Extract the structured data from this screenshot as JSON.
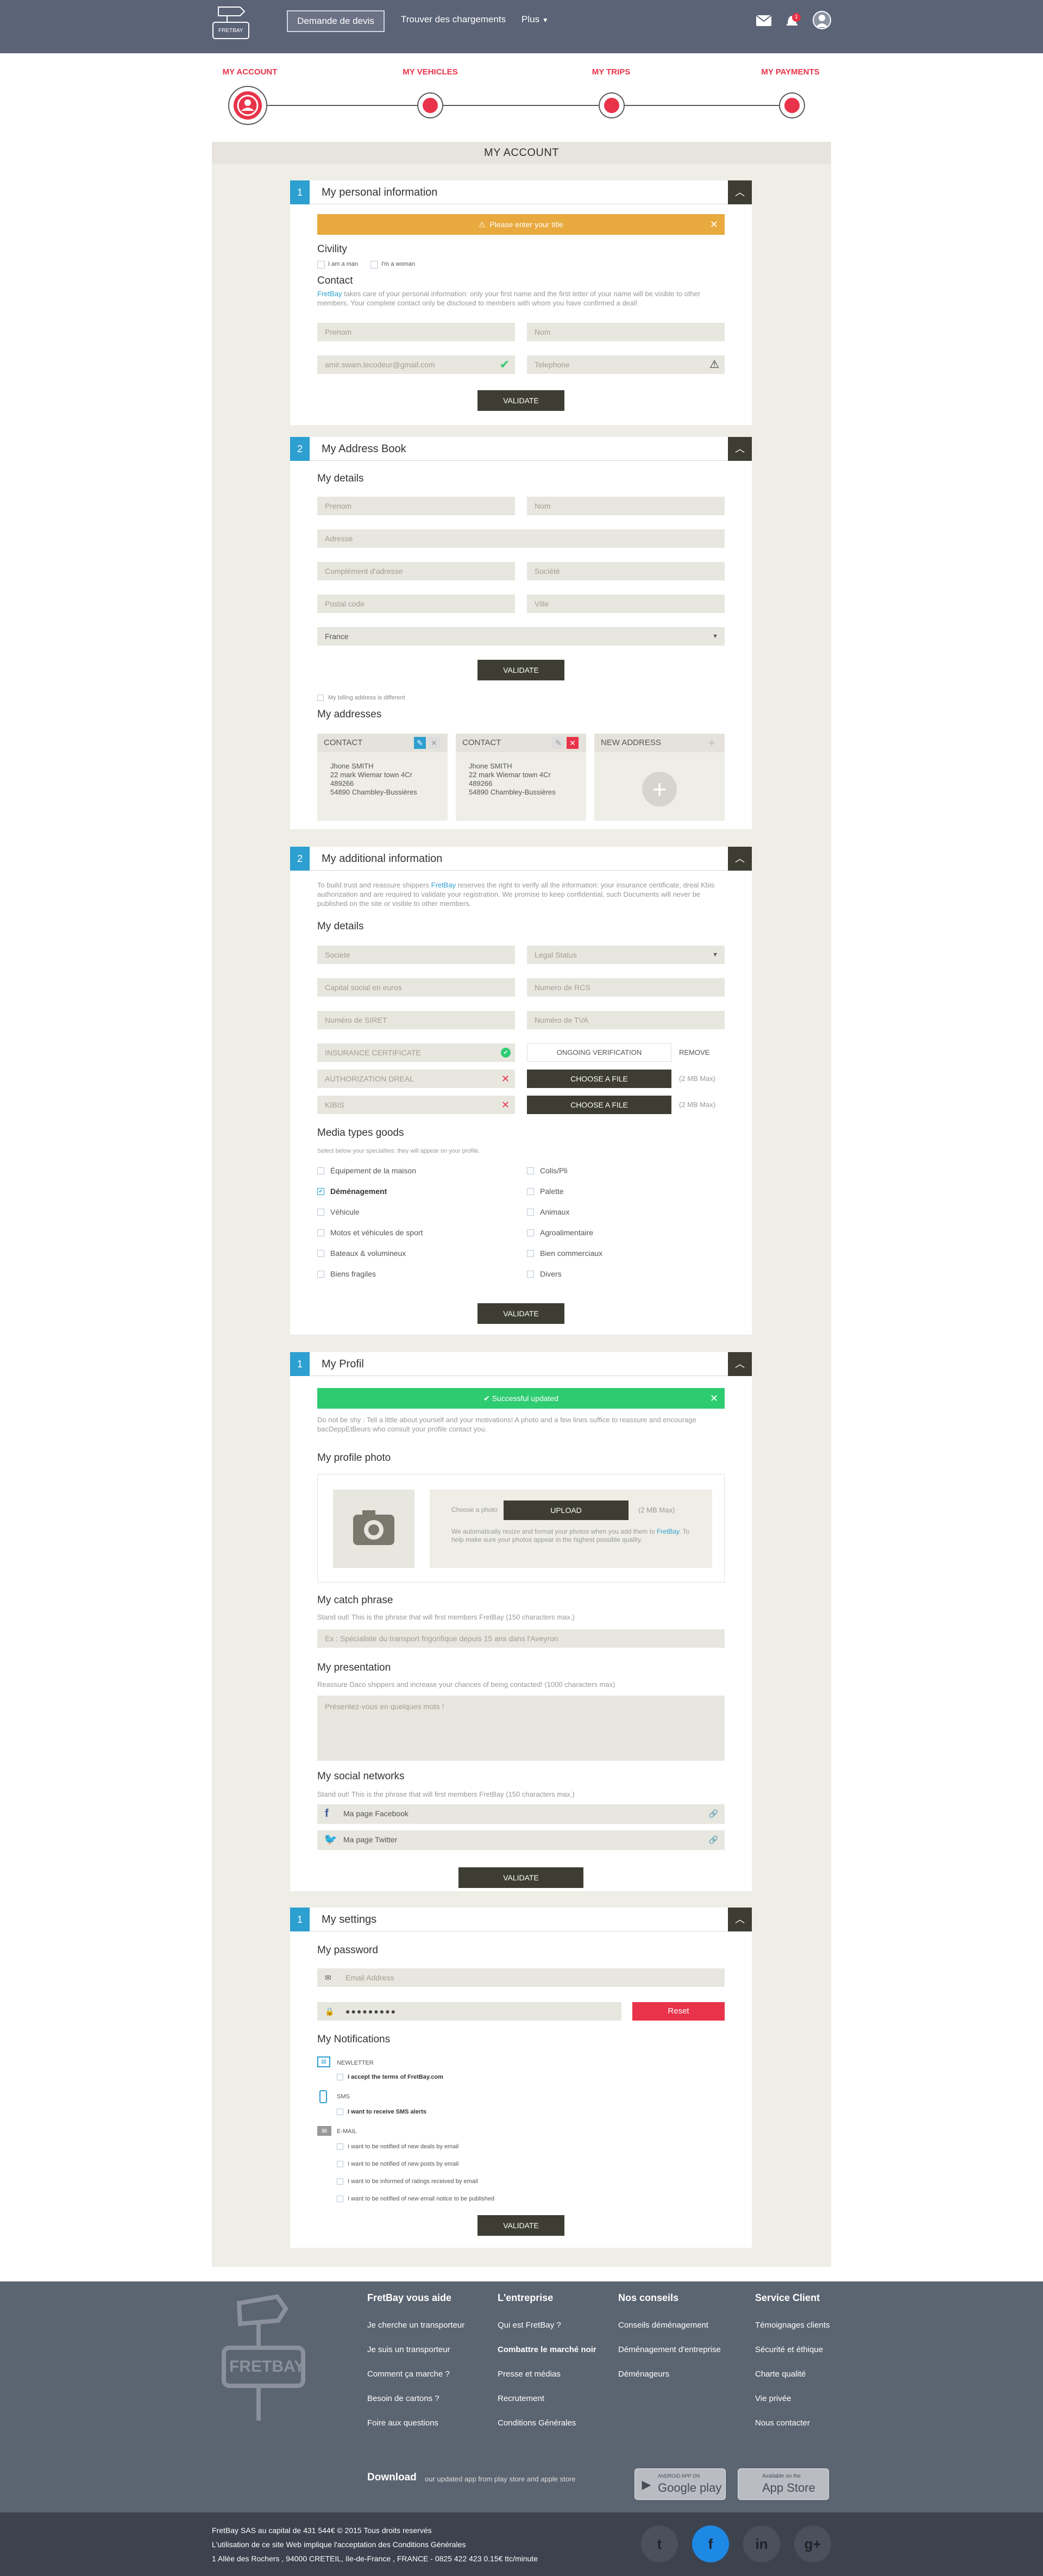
{
  "header": {
    "logo_text": "FRETBAY",
    "nav_quote": "Demande de devis",
    "nav_find": "Trouver des chargements",
    "nav_more": "Plus",
    "notif_count": "1"
  },
  "steps": [
    "MY ACCOUNT",
    "MY VEHICLES",
    "MY TRIPS",
    "MY PAYMENTS"
  ],
  "page_title": "MY ACCOUNT",
  "s1": {
    "num": "1",
    "title": "My personal information",
    "alert": "Please enter your title",
    "civility": "Civility",
    "man": "I am a man",
    "woman": "I'm a woman",
    "contact": "Contact",
    "desc_brand": "FretBay",
    "desc": " takes care of your personal information: only your first name and the first letter of your name will be visible to other members. Your complete contact only be disclosed to members with whom you have confirmed a deal!",
    "prenom": "Prenom",
    "nom": "Nom",
    "email": "amir.swam.lecodeur@gmail.com",
    "phone": "Telephone",
    "validate": "VALIDATE"
  },
  "s2": {
    "num": "2",
    "title": "My Address Book",
    "details": "My details",
    "prenom": "Prenom",
    "nom": "Nom",
    "adresse": "Adresse",
    "complement": "Complément d'adresse",
    "societe": "Société",
    "postal": "Postal code",
    "ville": "Ville",
    "country": "France",
    "validate": "VALIDATE",
    "billing": "My billing address is different",
    "addresses": "My addresses",
    "card_title": "CONTACT",
    "card_lines": [
      "Jhone SMITH",
      "22 mark Wiemar town 4Cr",
      "489266",
      "54890 Chambley-Bussières"
    ],
    "new_address": "NEW ADDRESS"
  },
  "s3": {
    "num": "2",
    "title": "My additional information",
    "intro_a": "To build trust and reassure shippers ",
    "intro_brand": "FretBay",
    "intro_b": " reserves the right to verify all the information: your insurance certificate, dreal Kbis authorization and are required to validate your registration. We promise to keep confidential, such Documents will never be published on the site or visible to other members.",
    "details": "My details",
    "societe": "Societe",
    "legal": "Legal Status",
    "capital": "Capital social en euros",
    "rcs": "Numero de RCS",
    "siret": "Numéro de SIRET",
    "tva": "Numéro de TVA",
    "doc1": "INSURANCE CERTIFICATE",
    "doc1_status": "ONGOING VERIFICATION",
    "doc1_remove": "REMOVE",
    "doc2": "AUTHORIZATION DREAL",
    "doc3": "KIBIS",
    "choose": "CHOOSE A FILE",
    "max": "(2 MB Max)",
    "media": "Media types goods",
    "media_hint": "Select below your specialties: they will appear on your profile.",
    "goods_left": [
      "Équipement de la maison",
      "Déménagement",
      "Véhicule",
      "Motos et véhicules de sport",
      "Bateaux & volumineux",
      "Biens fragiles"
    ],
    "goods_right": [
      "Colis/Pli",
      "Palette",
      "Animaux",
      "Agroalimentaire",
      "Bien commerciaux",
      "Divers"
    ],
    "validate": "VALIDATE"
  },
  "s4": {
    "num": "1",
    "title": "My Profil",
    "success": "Successful updated",
    "intro": "Do not be shy : Tell a little about yourself and your motivations! A photo and a few lines suffice to reassure and encourage bacDeppEtBeurs who consult your profile contact you.",
    "photo_title": "My profile photo",
    "choose_photo": "Choose a photo",
    "upload": "UPLOAD",
    "max": "(2 MB Max)",
    "photo_note_a": "We automatically resize and format your photos when you add them to ",
    "photo_brand": "FretBay",
    "photo_note_b": ". To help make sure your photos appear in the highest possible quality.",
    "catch_title": "My catch phrase",
    "catch_hint": "Stand out! This is the phrase that will first members FretBay (150 characters max.)",
    "catch_ph": "Ex : Spécialiste du transport frigorifique depuis 15 ans dans l'Aveyron",
    "pres_title": "My presentation",
    "pres_hint": "Reassure Daco shippers and increase your chances of being contacted! (1000 characters max)",
    "pres_ph": "Présentez-vous en quelques mots !",
    "social_title": "My social networks",
    "social_hint": "Stand out! This is the phrase that will first members FretBay (150 characters max.)",
    "facebook": "Ma page Facebook",
    "twitter": "Ma page Twitter",
    "validate": "VALIDATE"
  },
  "s5": {
    "num": "1",
    "title": "My settings",
    "pw_title": "My password",
    "email_ph": "Email Address",
    "password": "●●●●●●●●●",
    "reset": "Reset",
    "notif_title": "My Notifications",
    "newsletter": "NEWLETTER",
    "newsletter_opt": "I accept the terms of FretBay.com",
    "sms": "SMS",
    "sms_opt": "I want to receive SMS alerts",
    "email": "E-MAIL",
    "email_opts": [
      "I want to be notified of new deals by email",
      "I want to be notified of new posts by email",
      "I want to be informed of ratings received by email",
      "I want to be notified of new email notice to be published"
    ],
    "validate": "VALIDATE"
  },
  "footer": {
    "logo": "FRETBAY",
    "cols": [
      {
        "title": "FretBay vous aide",
        "links": [
          "Je cherche un transporteur",
          "Je suis un transporteur",
          "Comment ça marche ?",
          "Besoin de cartons ?",
          "Foire aux questions"
        ]
      },
      {
        "title": "L'entreprise",
        "links": [
          "Qui est FretBay ?",
          "Combattre le marché noir",
          "Presse et médias",
          "Recrutement",
          "Conditions Générales"
        ]
      },
      {
        "title": "Nos conseils",
        "links": [
          "Conseils déménagement",
          "Déménagement d'entreprise",
          "Déménageurs"
        ]
      },
      {
        "title": "Service Client",
        "links": [
          "Témoignages clients",
          "Sécurité et éthique",
          "Charte qualité",
          "Vie privée",
          "Nous contacter"
        ]
      }
    ],
    "download": "Download",
    "download_sub": "our updated app from play store and apple store",
    "gp_small": "ANDROID APP ON",
    "gp": "Google play",
    "as_small": "Available on the",
    "as": "App Store",
    "legal": [
      "FretBay SAS au capital de 431 544€ © 2015 Tous droits reservés",
      "L'utilisation de ce site Web implique l'acceptation des Conditions Générales",
      "1 Allée des Rochers , 94000 CRETEIL, Ile-de-France , FRANCE - 0825 422 423 0.15€ ttc/minute"
    ],
    "social": [
      "t",
      "f",
      "in",
      "g+"
    ]
  }
}
